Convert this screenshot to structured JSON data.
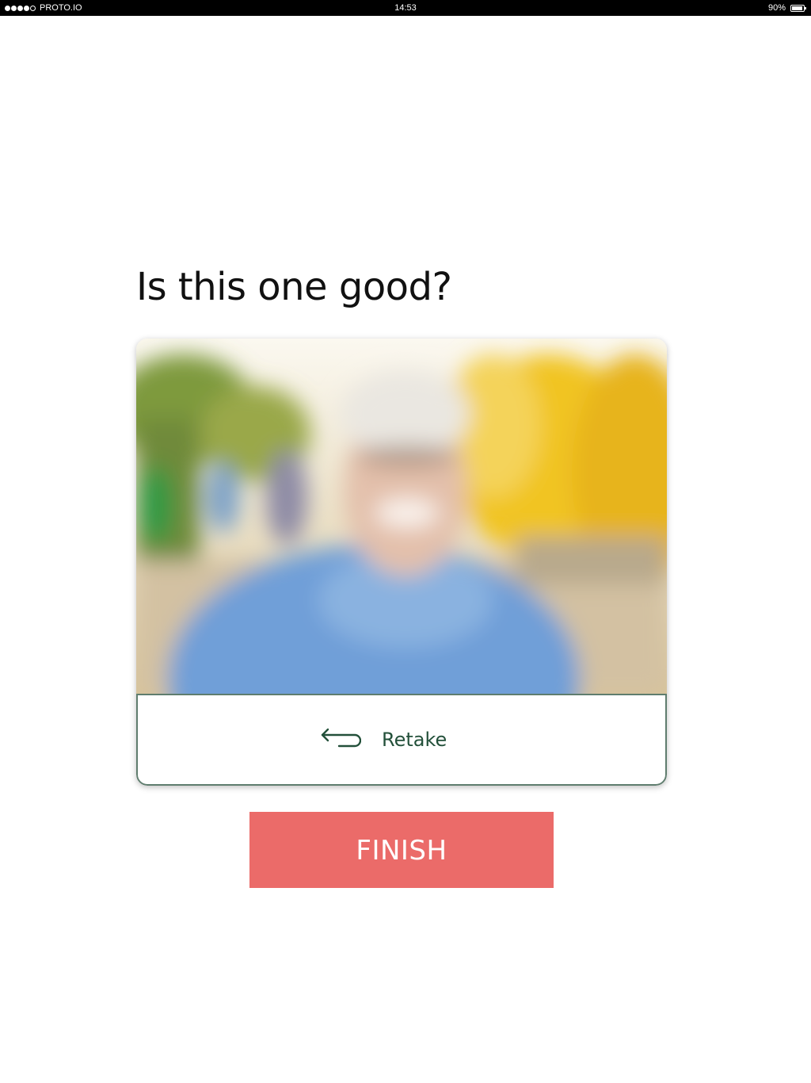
{
  "status_bar": {
    "carrier": "PROTO.IO",
    "time": "14:53",
    "battery_percent": "90%",
    "battery_level": 0.9,
    "signal_bars_filled": 4,
    "signal_bars_total": 5
  },
  "heading": "Is this one good?",
  "photo": {
    "description_icon": "photo-preview"
  },
  "retake": {
    "label": "Retake",
    "icon": "return-arrow-icon"
  },
  "finish_label": "FINISH",
  "colors": {
    "finish_bg": "#eb6b69",
    "retake_border": "#5f7d6e",
    "retake_text": "#23503a"
  }
}
